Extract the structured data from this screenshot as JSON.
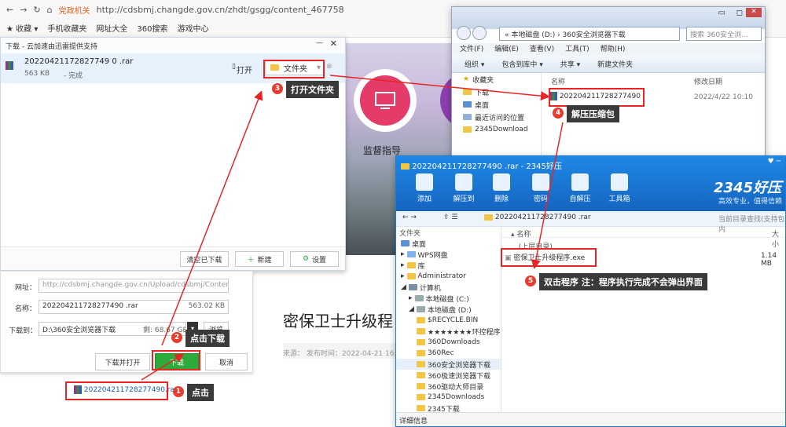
{
  "browser": {
    "site_badge": "党政机关",
    "url": "http://cdsbmj.changde.gov.cn/zhdt/gsgg/content_467758",
    "bookmarks": [
      "收藏",
      "手机收藏夹",
      "网址大全",
      "360搜索",
      "游戏中心"
    ]
  },
  "page": {
    "icon_label": "监督指导",
    "article_title": "密保卫士升级程",
    "article_meta": "来源：  发布时间：2022-04-21 16:46:5"
  },
  "downloader": {
    "title": "下载 - 云加速由迅雷提供支持",
    "file_name": "20220421172827749 0 .rar",
    "file_size": "563 KB",
    "status": "- 完成",
    "open_label": "打开",
    "folder_label": "文件夹",
    "clear_label": "清空已下载",
    "new_label": "新建",
    "settings_label": "设置"
  },
  "dialog": {
    "url_label": "网址：",
    "url_value": "http://cdsbmj.changde.gov.cn/Upload/cdsbmj/ContentMar",
    "name_label": "名称：",
    "name_value": "202204211728277490 .rar",
    "name_size": "563.02 KB",
    "saveto_label": "下载到：",
    "saveto_value": "D:\\360安全浏览器下载",
    "saveto_free": "剩: 68.67 GB",
    "browse_label": "浏览",
    "download_open_label": "下载并打开",
    "download_label": "下载",
    "cancel_label": "取消",
    "link_text": "202204211728277490.rar"
  },
  "explorer": {
    "path": "«  本地磁盘 (D:)  ›  360安全浏览器下载",
    "search_placeholder": "搜索 360安全浏...",
    "menu": [
      "文件(F)",
      "编辑(E)",
      "查看(V)",
      "工具(T)",
      "帮助(H)"
    ],
    "toolbar": [
      "组织 ▾",
      "包含到库中 ▾",
      "共享 ▾",
      "新建文件夹"
    ],
    "nav": [
      "收藏夹",
      "下载",
      "桌面",
      "最近访问的位置",
      "2345Download"
    ],
    "col_name": "名称",
    "col_date": "修改日期",
    "file_name": "202204211728277490",
    "file_date": "2022/4/22 10:10"
  },
  "haozip": {
    "title": "202204211728277490 .rar - 2345好压",
    "toolbar": [
      "添加",
      "解压到",
      "删除",
      "密码",
      "自解压",
      "工具箱"
    ],
    "brand": "2345好压",
    "slogan": "高效专业，值得信赖",
    "path": "202204211728277490 .rar",
    "search_placeholder": "当前目录查找(支持包内",
    "tree_header": "文件夹",
    "tree": [
      "桌面",
      "WPS网盘",
      "库",
      "Administrator",
      "计算机",
      "本地磁盘 (C:)",
      "本地磁盘 (D:)",
      "$RECYCLE.BIN",
      "★★★★★★★环控程序",
      "360Downloads",
      "360Rec",
      "360安全浏览器下载",
      "360极速浏览器下载",
      "360驱动大师目录",
      "2345Downloads",
      "2345下载"
    ],
    "col_name": "名称",
    "col_size": "大小",
    "parent": "..(上层目录)",
    "exe_name": "密保卫士升级程序.exe",
    "exe_size": "1.14 MB",
    "footer": "详细信息"
  },
  "annotations": [
    {
      "num": "1",
      "text": "点击"
    },
    {
      "num": "2",
      "text": "点击下载"
    },
    {
      "num": "3",
      "text": "打开文件夹"
    },
    {
      "num": "4",
      "text": "解压压缩包"
    },
    {
      "num": "5",
      "text": "双击程序 注：程序执行完成不会弹出界面"
    }
  ],
  "colors": {
    "accent_red": "#e82424",
    "haozip_blue": "#1e88e5",
    "download_green": "#2eaa3c"
  }
}
